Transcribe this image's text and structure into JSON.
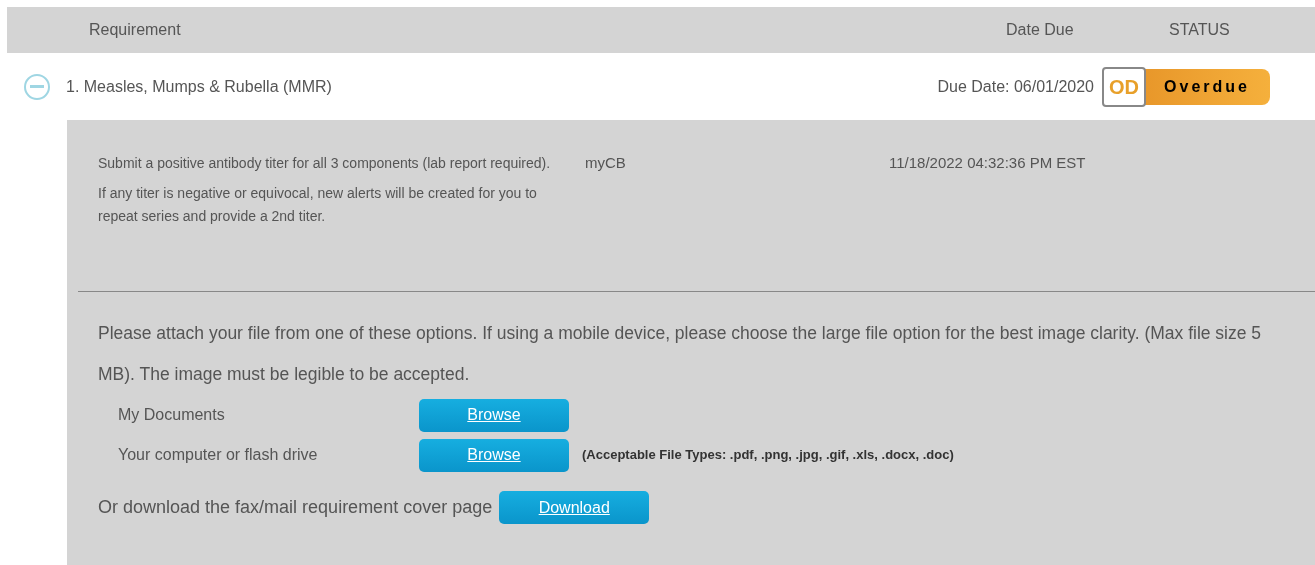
{
  "table": {
    "columns": [
      "Requirement",
      "Date Due",
      "STATUS"
    ],
    "rows": [
      {
        "title": "1. Measles, Mumps & Rubella (MMR)",
        "expanded": true,
        "due": "Due Date: 06/01/2020",
        "status": {
          "code": "OD",
          "label": "Overdue"
        },
        "details": {
          "instructions": [
            "Submit a positive antibody titer for all 3 components (lab report required).",
            "If any titer is negative or equivocal, new alerts will be created for you to repeat series and provide a 2nd titer."
          ],
          "source": "myCB",
          "timestamp": "11/18/2022 04:32:36 PM EST"
        },
        "upload": {
          "intro": "Please attach your file from one of these options. If using a mobile device, please choose the large file option for the best image clarity. (Max file size 5 MB). The image must be legible to be accepted.",
          "options": [
            {
              "label": "My Documents",
              "button": "Browse"
            },
            {
              "label": "Your computer or flash drive",
              "button": "Browse",
              "note": "(Acceptable File Types: .pdf, .png, .jpg, .gif, .xls, .docx, .doc)"
            }
          ],
          "download_text": "Or download the fax/mail requirement cover page",
          "download_button": "Download"
        }
      }
    ]
  }
}
